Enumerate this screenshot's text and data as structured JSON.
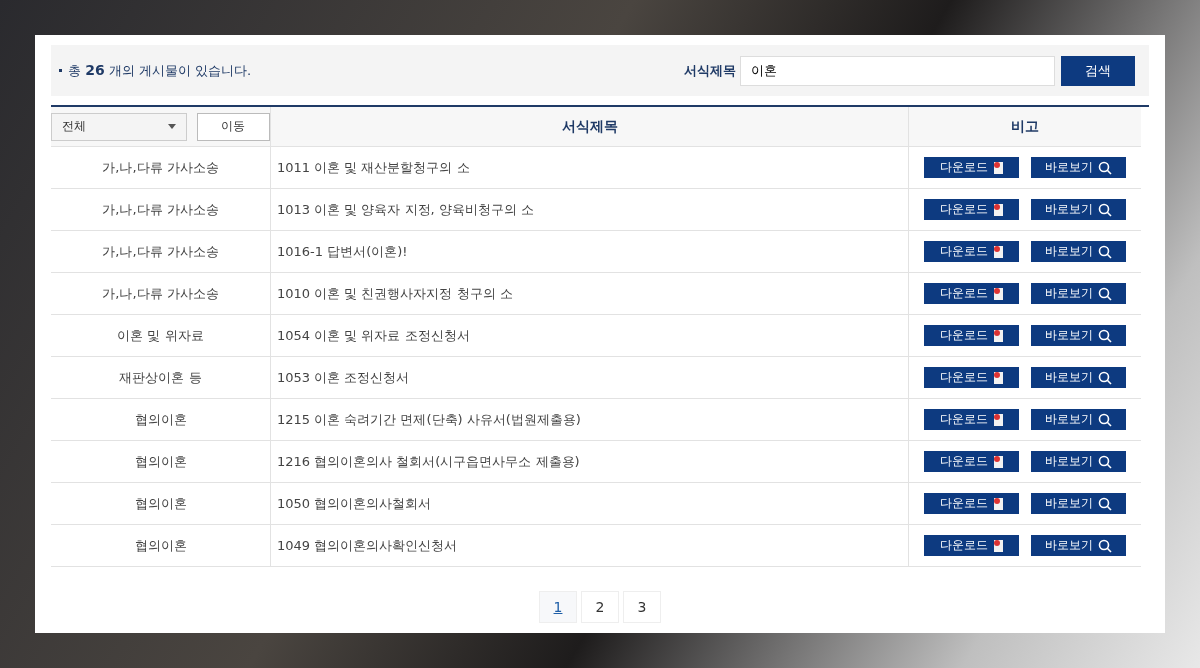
{
  "summary": "총 **26** 개의 게시물이 있습니다.",
  "search": {
    "label": "서식제목",
    "value": "이혼",
    "button": "검색"
  },
  "filter": {
    "value": "전체",
    "button": "이동"
  },
  "table": {
    "columns": [
      "서식제목",
      "비고"
    ],
    "rows": [
      {
        "category": "가,나,다류 가사소송",
        "title": "1011 이혼 및 재산분할청구의 소",
        "download": "다운로드",
        "view": "바로보기"
      },
      {
        "category": "가,나,다류 가사소송",
        "title": "1013 이혼 및 양육자 지정, 양육비청구의 소",
        "download": "다운로드",
        "view": "바로보기"
      },
      {
        "category": "가,나,다류 가사소송",
        "title": "1016-1 답변서(이혼)!",
        "download": "다운로드",
        "view": "바로보기"
      },
      {
        "category": "가,나,다류 가사소송",
        "title": "1010 이혼 및 친권행사자지정 청구의 소",
        "download": "다운로드",
        "view": "바로보기"
      },
      {
        "category": "이혼 및 위자료",
        "title": "1054 이혼 및 위자료 조정신청서",
        "download": "다운로드",
        "view": "바로보기"
      },
      {
        "category": "재판상이혼 등",
        "title": "1053 이혼 조정신청서",
        "download": "다운로드",
        "view": "바로보기"
      },
      {
        "category": "협의이혼",
        "title": "1215 이혼 숙려기간 면제(단축) 사유서(법원제출용)",
        "download": "다운로드",
        "view": "바로보기"
      },
      {
        "category": "협의이혼",
        "title": "1216 협의이혼의사 철회서(시구읍면사무소 제출용)",
        "download": "다운로드",
        "view": "바로보기"
      },
      {
        "category": "협의이혼",
        "title": "1050 협의이혼의사철회서",
        "download": "다운로드",
        "view": "바로보기"
      },
      {
        "category": "협의이혼",
        "title": "1049 협의이혼의사확인신청서",
        "download": "다운로드",
        "view": "바로보기"
      }
    ]
  },
  "pagination": [
    {
      "label": "1",
      "selected": true
    },
    {
      "label": "2",
      "selected": false
    },
    {
      "label": "3",
      "selected": false
    }
  ]
}
